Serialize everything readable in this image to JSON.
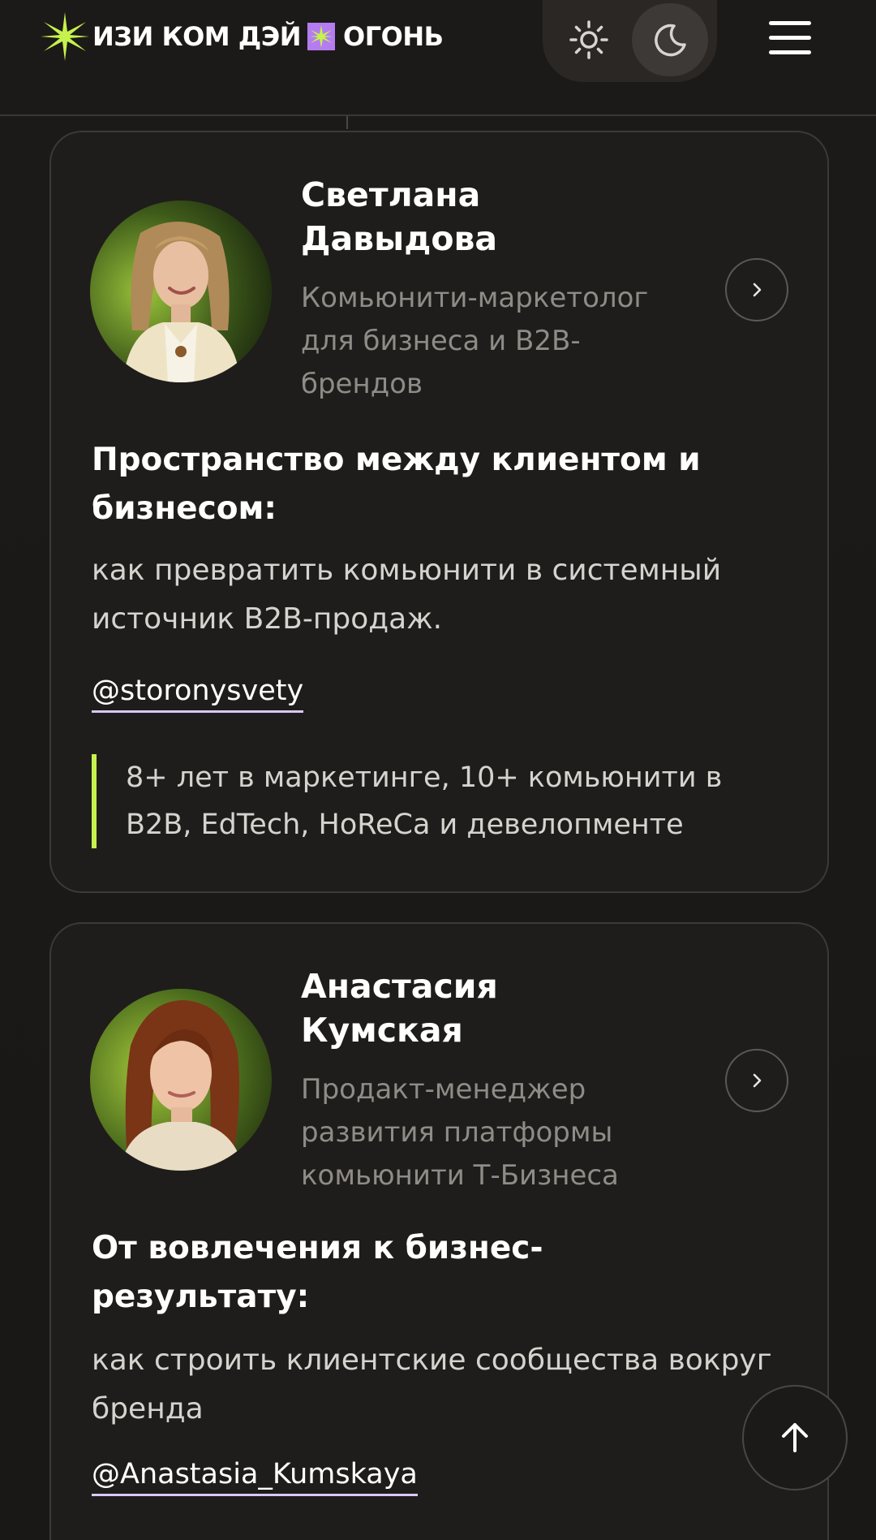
{
  "header": {
    "logo_text_left": "ИЗИ КОМ ДЭЙ",
    "logo_text_right": "ОГОНЬ",
    "accent_color": "#c6f24e",
    "accent_secondary": "#b57cf0",
    "theme": {
      "light_icon": "sun-icon",
      "dark_icon": "moon-icon",
      "active": "dark"
    },
    "menu_icon": "hamburger-menu-icon"
  },
  "speakers": [
    {
      "name": "Светлана Давыдова",
      "role": "Комьюнити-маркетолог для бизнеса и B2B-брендов",
      "topic": "Пространство между клиентом и бизнесом:",
      "description": "как превратить комьюнити в системный источник B2B-продаж.",
      "handle": "@storonysvety",
      "quote": "8+ лет в маркетинге, 10+ комьюнити в B2B, EdTech, HoReCa и девелопменте"
    },
    {
      "name": "Анастасия Кумская",
      "role": "Продакт-менеджер развития платформы комьюнити Т-Бизнеса",
      "topic": "От вовлечения к бизнес-результату:",
      "description": "как строить клиентские сообщества вокруг бренда",
      "handle": "@Anastasia_Kumskaya"
    }
  ],
  "icons": {
    "speaker_link": "chevron-right-icon",
    "scroll_top": "arrow-up-icon"
  },
  "colors": {
    "background": "#1b1918",
    "card_border": "#3d3936",
    "muted_text": "#8f8b87",
    "underline": "#d9c8ff"
  }
}
